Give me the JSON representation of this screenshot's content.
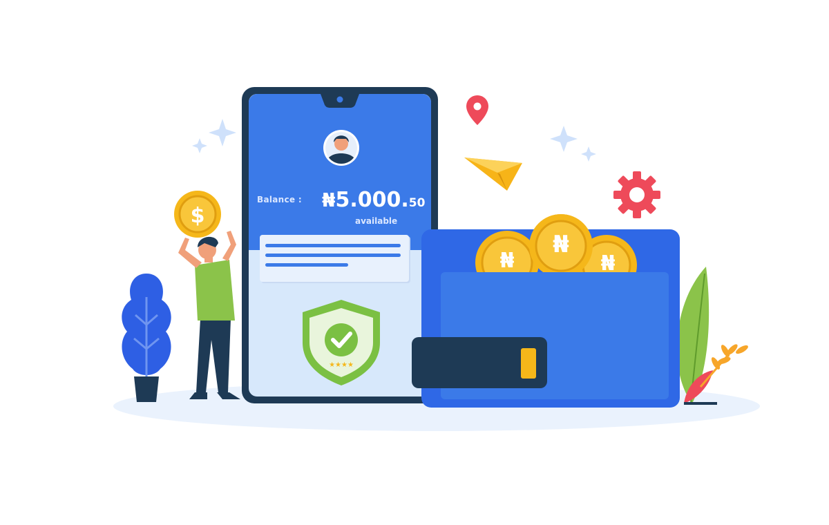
{
  "balance": {
    "label": "Balance :",
    "currency_symbol": "₦",
    "amount_main": "5.000.",
    "amount_cents": "50",
    "status": "available"
  },
  "coins": {
    "left_symbol": "₦",
    "center_symbol": "₦",
    "right_symbol": "₦"
  },
  "held_coin": {
    "symbol": "$"
  },
  "shield": {
    "rating_stars": "★★★★",
    "rating_value": 4
  },
  "colors": {
    "phone_frame": "#1e3a55",
    "screen_blue": "#3b7ae8",
    "wallet_blue": "#2f68e6",
    "coin_gold": "#f5b71a",
    "accent_red": "#ee4a5a",
    "paper_plane": "#f7b418",
    "shield_green": "#7bc043",
    "plant_blue": "#2e5fe4"
  },
  "icons": [
    "user-avatar-icon",
    "location-pin-icon",
    "paper-plane-icon",
    "gear-icon",
    "sparkle-icon",
    "shield-check-icon",
    "plant-icon",
    "leaf-icon"
  ]
}
